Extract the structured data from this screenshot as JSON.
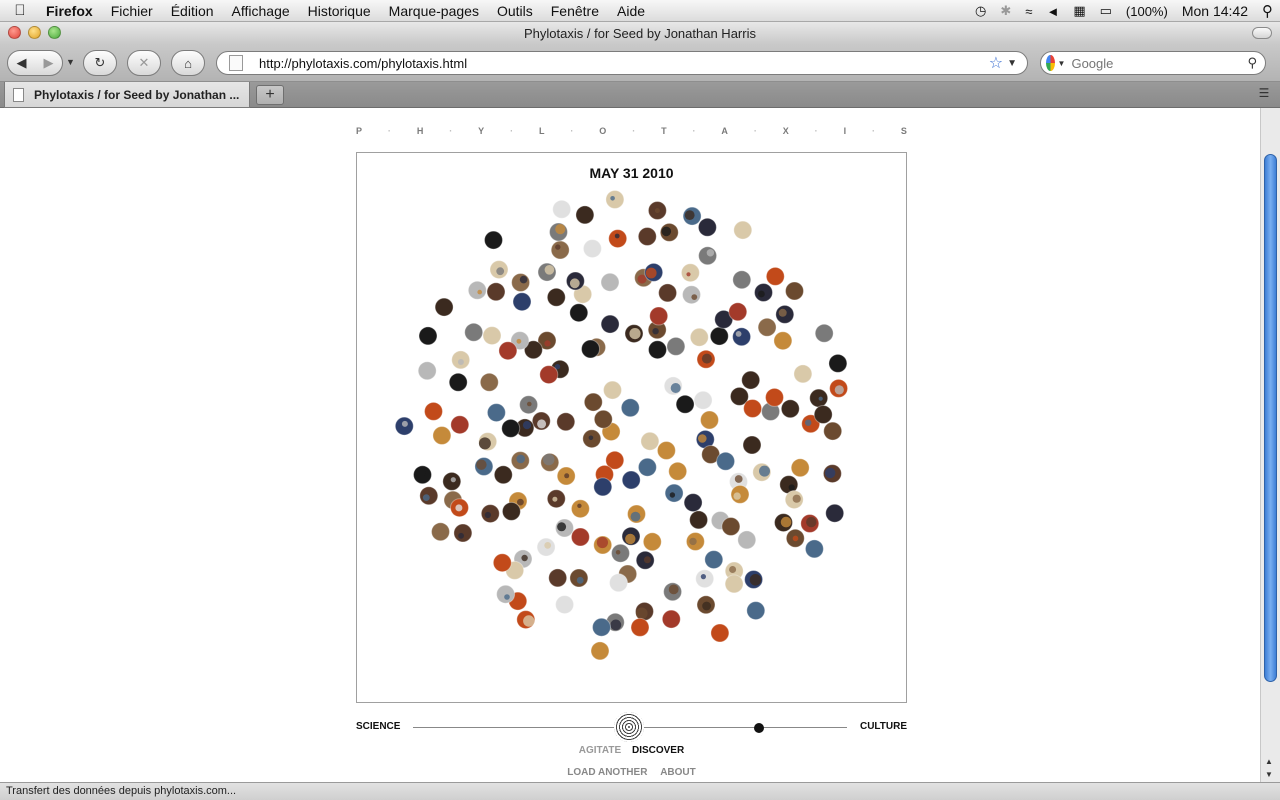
{
  "menubar": {
    "app": "Firefox",
    "items": [
      "Fichier",
      "Édition",
      "Affichage",
      "Historique",
      "Marque-pages",
      "Outils",
      "Fenêtre",
      "Aide"
    ],
    "battery": "(100%)",
    "clock": "Mon 14:42"
  },
  "window": {
    "title": "Phylotaxis / for Seed by Jonathan Harris"
  },
  "toolbar": {
    "url": "http://phylotaxis.com/phylotaxis.html",
    "search_placeholder": "Google"
  },
  "tabs": [
    {
      "label": "Phylotaxis / for Seed by Jonathan ..."
    }
  ],
  "page": {
    "title_letters": [
      "P",
      "H",
      "Y",
      "L",
      "O",
      "T",
      "A",
      "X",
      "I",
      "S"
    ],
    "date": "MAY 31 2010",
    "slider": {
      "left_label": "SCIENCE",
      "right_label": "CULTURE"
    },
    "modes": {
      "agitate": "AGITATE",
      "discover": "DISCOVER"
    },
    "links": {
      "load_another": "LOAD ANOTHER",
      "about": "ABOUT"
    }
  },
  "status": "Transfert des données depuis phylotaxis.com...",
  "colors": {
    "scroll_accent": "#3e7fd6",
    "knob": "#111111"
  }
}
